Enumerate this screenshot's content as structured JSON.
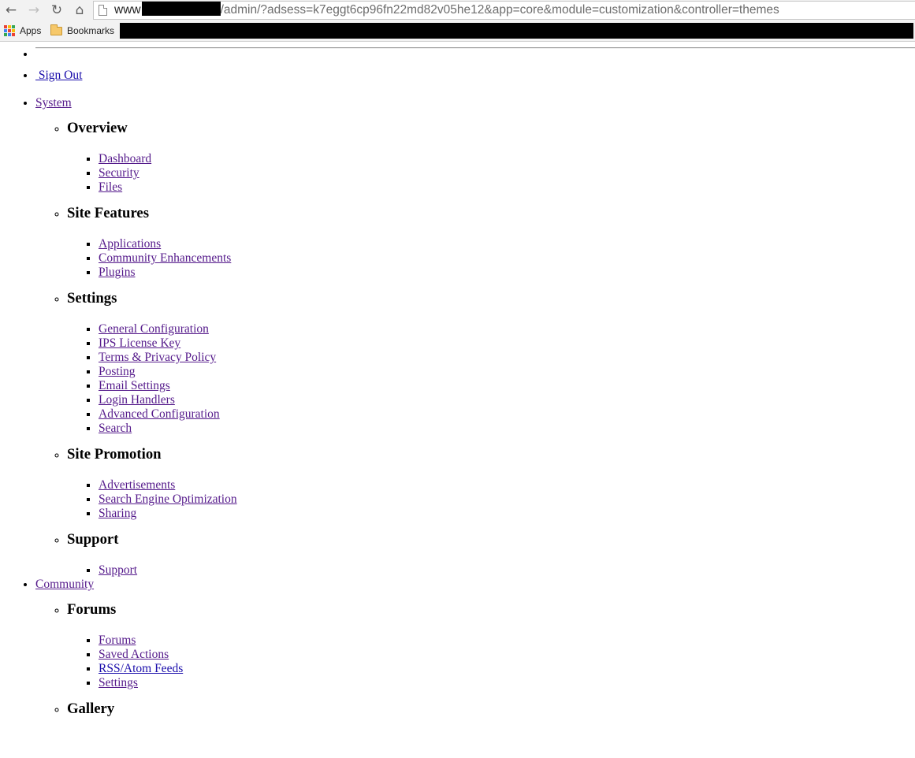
{
  "browser": {
    "url_host": "www",
    "url_path": "/admin/?adsess=k7eggt6cp96fn22md82v05he12&app=core&module=customization&controller=themes",
    "bookmarks": [
      {
        "label": "Apps",
        "icon": "apps-grid-icon"
      },
      {
        "label": "Bookmarks",
        "icon": "folder-icon"
      }
    ],
    "nav_icons": [
      "back-arrow-icon",
      "forward-arrow-icon",
      "reload-icon",
      "home-icon"
    ]
  },
  "page": {
    "sign_out": " Sign Out",
    "sections": [
      {
        "label": "System",
        "groups": [
          {
            "title": "Overview",
            "links": [
              "Dashboard",
              "Security",
              "Files"
            ]
          },
          {
            "title": "Site Features",
            "links": [
              "Applications",
              "Community Enhancements",
              "Plugins"
            ]
          },
          {
            "title": "Settings",
            "links": [
              "General Configuration",
              "IPS License Key",
              "Terms & Privacy Policy",
              "Posting",
              "Email Settings",
              "Login Handlers",
              "Advanced Configuration",
              "Search"
            ]
          },
          {
            "title": "Site Promotion",
            "links": [
              "Advertisements",
              "Search Engine Optimization",
              "Sharing"
            ]
          },
          {
            "title": "Support",
            "links": [
              "Support"
            ]
          }
        ]
      },
      {
        "label": "Community",
        "groups": [
          {
            "title": "Forums",
            "links": [
              "Forums",
              "Saved Actions",
              "RSS/Atom Feeds",
              "Settings"
            ]
          },
          {
            "title": "Gallery",
            "links": []
          }
        ]
      }
    ]
  },
  "colors": {
    "link": "#1a0dab",
    "visited_link": "#551a8b",
    "chrome_bg": "#f2f2f2"
  }
}
